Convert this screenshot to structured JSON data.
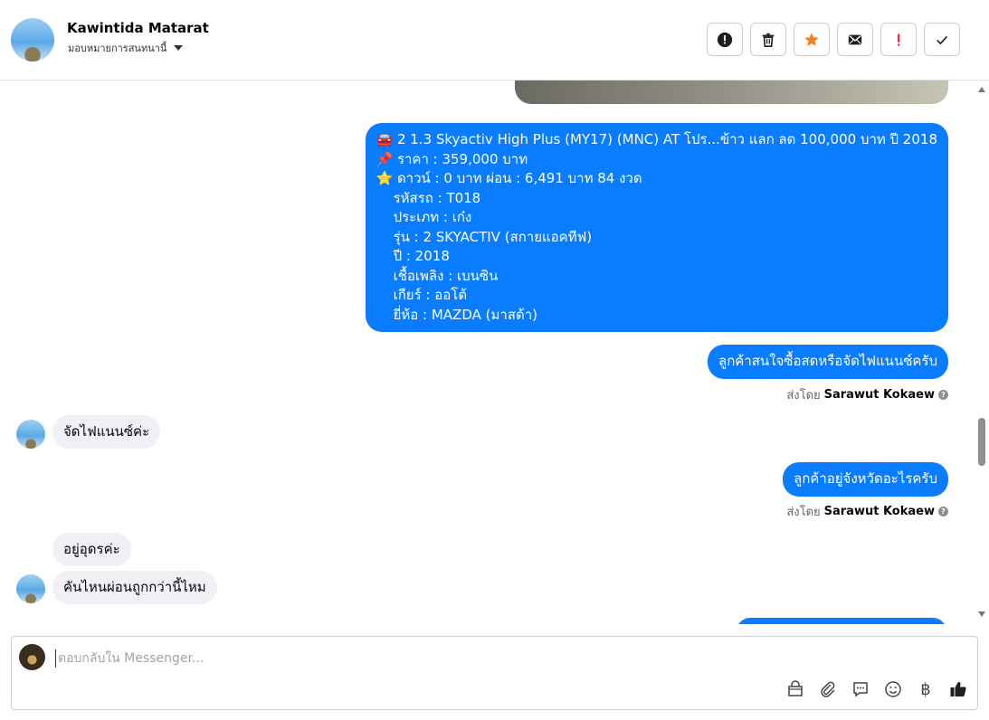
{
  "header": {
    "contact_name": "Kawintida Matarat",
    "assign_label": "มอบหมายการสนทนานี้",
    "actions": [
      {
        "name": "report-button",
        "icon": "alert-circle-icon"
      },
      {
        "name": "delete-button",
        "icon": "trash-icon"
      },
      {
        "name": "star-button",
        "icon": "star-icon"
      },
      {
        "name": "mark-unread-button",
        "icon": "envelope-icon"
      },
      {
        "name": "spam-button",
        "icon": "exclamation-icon"
      },
      {
        "name": "done-button",
        "icon": "check-icon"
      }
    ]
  },
  "thread": {
    "car_listing_lines": [
      "🚘 2 1.3 Skyactiv High Plus (MY17) (MNC) AT โปร...ข้าว แลก ลด 100,000 บาท ปี 2018",
      "📌 ราคา : 359,000 บาท",
      "⭐ ดาวน์ : 0 บาท ผ่อน : 6,491 บาท 84 งวด",
      "    รหัสรถ : T018",
      "    ประเภท : เก๋ง",
      "    รุ่น : 2 SKYACTIV (สกายแอคทีฟ)",
      "    ปี : 2018",
      "    เชื้อเพลิง : เบนซิน",
      "    เกียร์ : ออโต้",
      "    ยี่ห้อ : MAZDA (มาสด้า)"
    ],
    "msg_out_1": "ลูกค้าสนใจซื้อสดหรือจัดไฟแนนซ์ครับ",
    "sent_by_prefix": "ส่งโดย",
    "sent_by_name": "Sarawut Kokaew",
    "msg_in_1": "จัดไฟแนนซ์ค่ะ",
    "msg_out_2": "ลูกค้าอยู่จังหวัดอะไรครับ",
    "msg_in_2": "อยู่อุดรค่ะ",
    "msg_in_3": "คันไหนผ่อนถูกกว่านี้ไหม"
  },
  "composer": {
    "placeholder": "ตอบกลับใน Messenger...",
    "tools": [
      "shop-icon",
      "paperclip-icon",
      "saved-reply-icon",
      "emoji-icon",
      "baht-icon",
      "thumbs-up-icon"
    ],
    "baht_symbol": "฿"
  },
  "colors": {
    "outgoing_bubble": "#0a7cff",
    "incoming_bubble": "#eff1f4",
    "star": "#f5811f",
    "spam": "#e41e3f"
  }
}
